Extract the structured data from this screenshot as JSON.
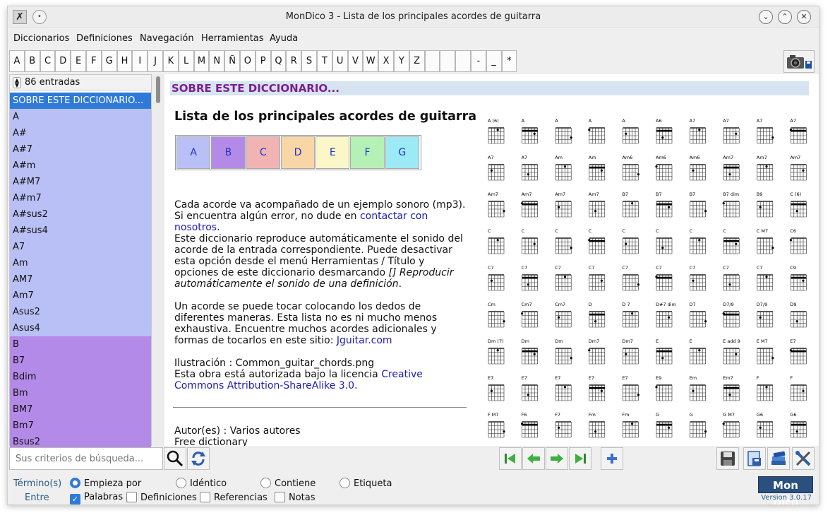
{
  "window": {
    "title": "MonDico 3 - Lista de los principales acordes de guitarra"
  },
  "menu": [
    "Diccionarios",
    "Definiciones",
    "Navegación",
    "Herramientas",
    "Ayuda"
  ],
  "letters": [
    "A",
    "B",
    "C",
    "D",
    "E",
    "F",
    "G",
    "H",
    "I",
    "J",
    "K",
    "L",
    "M",
    "N",
    "Ñ",
    "O",
    "P",
    "Q",
    "R",
    "S",
    "T",
    "U",
    "V",
    "W",
    "X",
    "Y",
    "Z",
    "",
    "",
    "",
    "-",
    "_",
    "*"
  ],
  "left_panel": {
    "count_label": "86 entradas",
    "entries": [
      {
        "label": "SOBRE ESTE DICCIONARIO...",
        "color": "#2f7ad8",
        "selected": true
      },
      {
        "label": "A",
        "color": "#b9c0f6"
      },
      {
        "label": "A#",
        "color": "#b9c0f6"
      },
      {
        "label": "A#7",
        "color": "#b9c0f6"
      },
      {
        "label": "A#m",
        "color": "#b9c0f6"
      },
      {
        "label": "A#M7",
        "color": "#b9c0f6"
      },
      {
        "label": "A#m7",
        "color": "#b9c0f6"
      },
      {
        "label": "A#sus2",
        "color": "#b9c0f6"
      },
      {
        "label": "A#sus4",
        "color": "#b9c0f6"
      },
      {
        "label": "A7",
        "color": "#b9c0f6"
      },
      {
        "label": "Am",
        "color": "#b9c0f6"
      },
      {
        "label": "AM7",
        "color": "#b9c0f6"
      },
      {
        "label": "Am7",
        "color": "#b9c0f6"
      },
      {
        "label": "Asus2",
        "color": "#b9c0f6"
      },
      {
        "label": "Asus4",
        "color": "#b9c0f6"
      },
      {
        "label": "B",
        "color": "#b48ae8"
      },
      {
        "label": "B7",
        "color": "#b48ae8"
      },
      {
        "label": "Bdim",
        "color": "#b48ae8"
      },
      {
        "label": "Bm",
        "color": "#b48ae8"
      },
      {
        "label": "BM7",
        "color": "#b48ae8"
      },
      {
        "label": "Bm7",
        "color": "#b48ae8"
      },
      {
        "label": "Bsus2",
        "color": "#b48ae8"
      }
    ]
  },
  "content": {
    "section_title": "SOBRE ESTE DICCIONARIO...",
    "doc_title": "Lista de los principales acordes de guitarra",
    "letter_table": [
      {
        "label": "A",
        "color": "#b9c0f6"
      },
      {
        "label": "B",
        "color": "#b48ae8"
      },
      {
        "label": "C",
        "color": "#f2b3b3"
      },
      {
        "label": "D",
        "color": "#f9d6a6"
      },
      {
        "label": "E",
        "color": "#fbf7c8"
      },
      {
        "label": "F",
        "color": "#b5f0b5"
      },
      {
        "label": "G",
        "color": "#9beaf5"
      }
    ],
    "p1_text": "Cada acorde va acompañado de un ejemplo sonoro (mp3). Si encuentra algún error, no dude en ",
    "p1_link": "contactar con nosotros",
    "p1_end": ".",
    "p2_text": "Este diccionario reproduce automáticamente el sonido del acorde de la entrada correspondiente. Puede desactivar esta opción desde el menú Herramientas / Título y opciones de este diccionario desmarcando ",
    "p2_italic": "[] Reproducir automáticamente el sonido de una definición",
    "p2_end": ".",
    "p3_text": "Un acorde se puede tocar colocando los dedos de diferentes maneras. Esta lista no es ni mucho menos exhaustiva. Encuentre muchos acordes adicionales y formas de tocarlos en este sitio: ",
    "p3_link": "Jguitar.com",
    "p4_line1": "Ilustración : Common_guitar_chords.png",
    "p4_text": "Esta obra está autorizada bajo la licencia ",
    "p4_link": "Creative Commons Attribution-ShareAlike 3.0",
    "p4_end": ".",
    "author": "Autor(es) : Varios autores",
    "license": "Free dictionary",
    "chord_names": [
      "A (6)",
      "A",
      "A",
      "A",
      "A",
      "A6",
      "A7",
      "A7",
      "A7",
      "A7",
      "A7",
      "A7",
      "Am",
      "Am",
      "Am6",
      "Am6",
      "Am6",
      "Am7",
      "Am7",
      "Am7",
      "Am7",
      "Am7",
      "Am7",
      "Am7",
      "B7",
      "B7",
      "B7",
      "B7 dim",
      "B9",
      "C (6)",
      "C",
      "C",
      "C",
      "C",
      "C",
      "C",
      "C",
      "C",
      "C M7",
      "C6",
      "C7",
      "C7",
      "C7",
      "C7",
      "C7",
      "C7",
      "C7",
      "C7",
      "C7",
      "C9",
      "Cm",
      "Cm7",
      "Cm7",
      "D",
      "D 7",
      "D#7 dim",
      "D7",
      "D7/9",
      "D7/9",
      "D9",
      "Dm (7)",
      "Dm",
      "Dm",
      "Dm7",
      "Dm7",
      "E",
      "E",
      "E add 9",
      "E M7",
      "E7",
      "E7",
      "E7",
      "E7",
      "E7",
      "E7",
      "E9",
      "Em",
      "Em7",
      "F",
      "F",
      "F M7",
      "F6",
      "F7",
      "Fm",
      "Fm",
      "G",
      "G",
      "G M7",
      "G6",
      "G6"
    ]
  },
  "search": {
    "placeholder": "Sus criterios de búsqueda..."
  },
  "options": {
    "terms_label": "Término(s)",
    "between_label": "Entre",
    "radios": [
      {
        "label": "Empieza por",
        "checked": true
      },
      {
        "label": "Idéntico",
        "checked": false
      },
      {
        "label": "Contiene",
        "checked": false
      },
      {
        "label": "Etiqueta",
        "checked": false
      }
    ],
    "checks": [
      {
        "label": "Palabras",
        "checked": true
      },
      {
        "label": "Definiciones",
        "checked": false
      },
      {
        "label": "Referencias",
        "checked": false
      },
      {
        "label": "Notas",
        "checked": false
      }
    ]
  },
  "brand": {
    "logo": "Mon Dico",
    "version": "Version 3.0.17"
  }
}
